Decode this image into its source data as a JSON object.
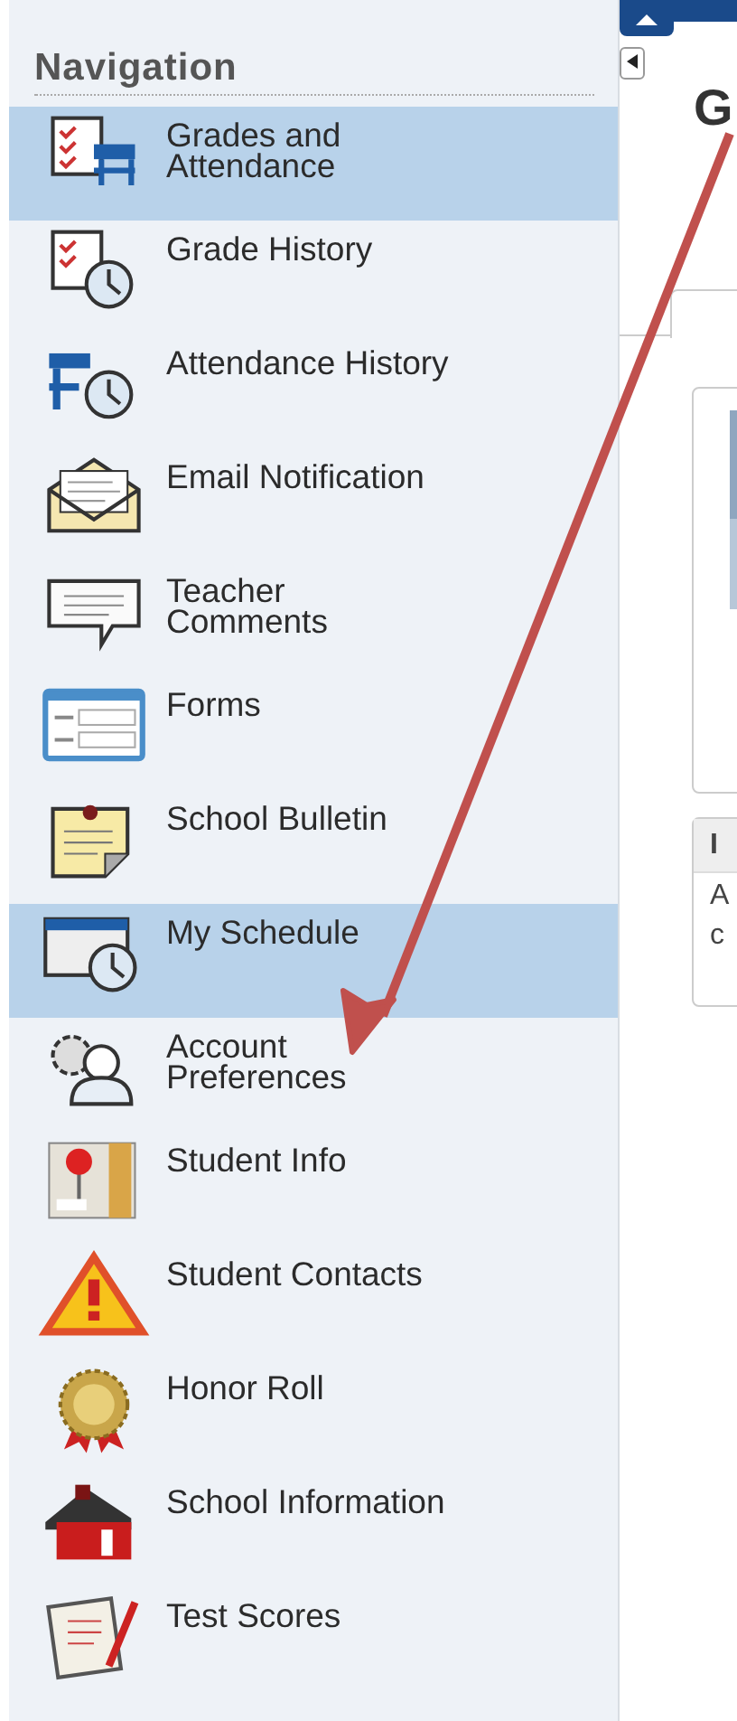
{
  "sidebar": {
    "title": "Navigation",
    "items": [
      {
        "label": "Grades and Attendance",
        "selected": true
      },
      {
        "label": "Grade History",
        "selected": false
      },
      {
        "label": "Attendance History",
        "selected": false
      },
      {
        "label": "Email Notification",
        "selected": false
      },
      {
        "label": "Teacher Comments",
        "selected": false
      },
      {
        "label": "Forms",
        "selected": false
      },
      {
        "label": "School Bulletin",
        "selected": false
      },
      {
        "label": "My Schedule",
        "selected": true
      },
      {
        "label": "Account Preferences",
        "selected": false
      },
      {
        "label": "Student Info",
        "selected": false
      },
      {
        "label": "Student Contacts",
        "selected": false
      },
      {
        "label": "Honor Roll",
        "selected": false
      },
      {
        "label": "School Information",
        "selected": false
      },
      {
        "label": "Test Scores",
        "selected": false
      }
    ]
  },
  "main": {
    "title": "G",
    "panel_header": "I",
    "panel_lines": [
      "A",
      "c"
    ]
  }
}
